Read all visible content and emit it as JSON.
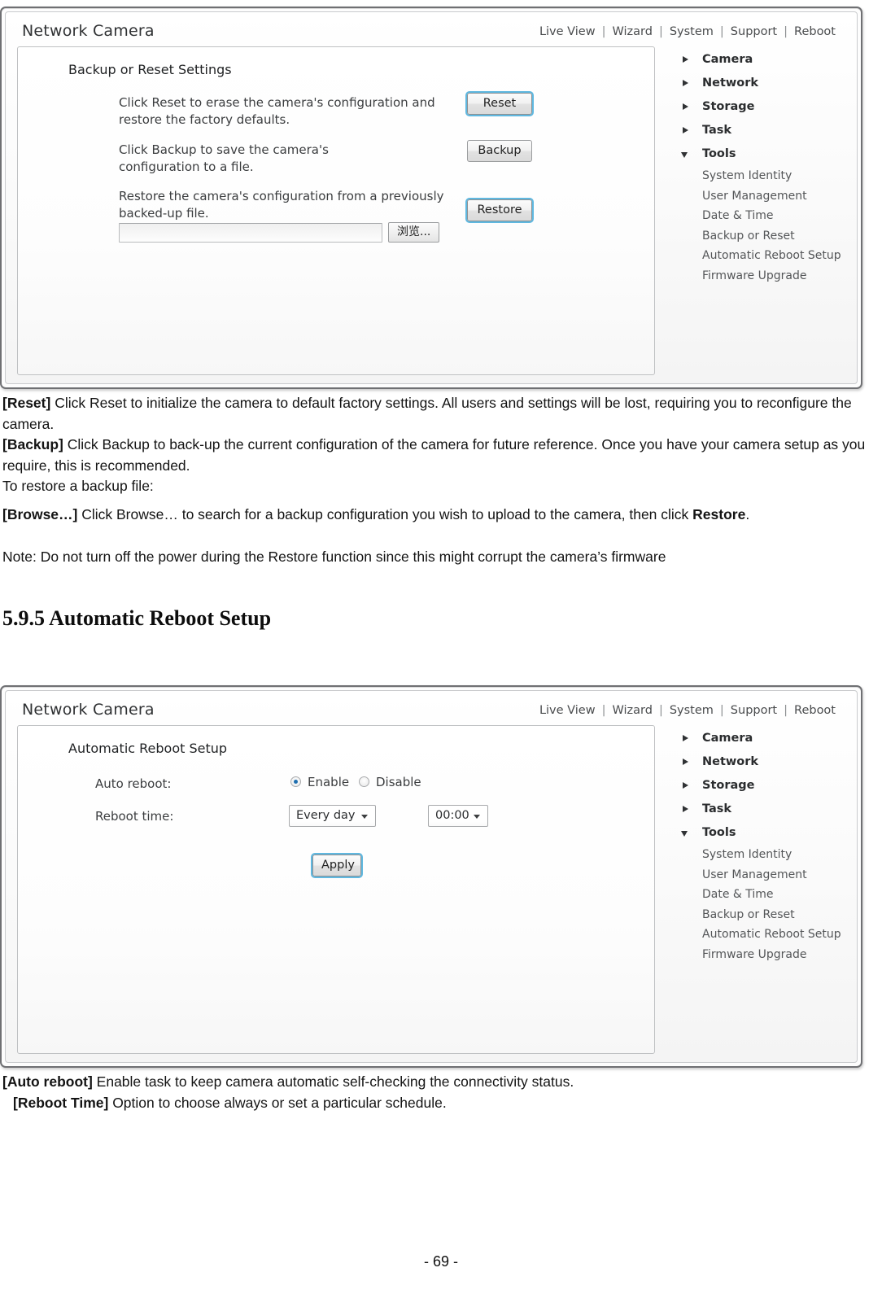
{
  "page": {
    "number_label": "- 69 -"
  },
  "screenshot1": {
    "brand": "Network Camera",
    "nav": [
      "Live View",
      "Wizard",
      "System",
      "Support",
      "Reboot"
    ],
    "nav_separator": "|",
    "section_title": "Backup or Reset Settings",
    "rows": [
      {
        "desc": "Click Reset to erase the camera's configuration and restore the factory defaults.",
        "button": "Reset"
      },
      {
        "desc": "Click Backup to save the camera's configuration to a file.",
        "button": "Backup"
      },
      {
        "desc": "Restore the camera's configuration from a previously backed-up file.",
        "button": "Restore"
      }
    ],
    "file_input_value": "",
    "browse_button": "浏览...",
    "sidebar": [
      {
        "label": "Camera",
        "type": "group",
        "expanded": false
      },
      {
        "label": "Network",
        "type": "group",
        "expanded": false
      },
      {
        "label": "Storage",
        "type": "group",
        "expanded": false
      },
      {
        "label": "Task",
        "type": "group",
        "expanded": false
      },
      {
        "label": "Tools",
        "type": "group",
        "expanded": true
      },
      {
        "label": "System Identity",
        "type": "leaf"
      },
      {
        "label": "User Management",
        "type": "leaf"
      },
      {
        "label": "Date & Time",
        "type": "leaf"
      },
      {
        "label": "Backup or Reset",
        "type": "leaf"
      },
      {
        "label": "Automatic Reboot Setup",
        "type": "leaf"
      },
      {
        "label": "Firmware Upgrade",
        "type": "leaf"
      }
    ]
  },
  "body_text_1": {
    "p1_bold": "[Reset]",
    "p1": " Click Reset to initialize the camera to default factory settings. All users and settings will be lost, requiring you to reconfigure the camera.",
    "p2_bold": "[Backup]",
    "p2": " Click Backup to back-up the current configuration of the camera for future reference. Once you have your camera setup as you require, this is recommended.",
    "p3": "To restore a backup file:",
    "p4_bold": "[Browse…]",
    "p4a": " Click Browse… to search for a backup configuration you wish to upload to the camera, then click ",
    "p4_bold2": "Restore",
    "p4b": ".",
    "p5": "Note: Do not turn off the power during the Restore function since this might corrupt the camera’s firmware"
  },
  "heading": {
    "text": "5.9.5 Automatic Reboot Setup"
  },
  "screenshot2": {
    "brand": "Network Camera",
    "nav": [
      "Live View",
      "Wizard",
      "System",
      "Support",
      "Reboot"
    ],
    "nav_separator": "|",
    "section_title": "Automatic Reboot Setup",
    "auto_reboot_label": "Auto reboot:",
    "enable_label": "Enable",
    "disable_label": "Disable",
    "auto_reboot_selected": "Enable",
    "reboot_time_label": "Reboot time:",
    "reboot_day_value": "Every day",
    "reboot_clock_value": "00:00",
    "apply_button": "Apply",
    "sidebar": [
      {
        "label": "Camera",
        "type": "group",
        "expanded": false
      },
      {
        "label": "Network",
        "type": "group",
        "expanded": false
      },
      {
        "label": "Storage",
        "type": "group",
        "expanded": false
      },
      {
        "label": "Task",
        "type": "group",
        "expanded": false
      },
      {
        "label": "Tools",
        "type": "group",
        "expanded": true
      },
      {
        "label": "System Identity",
        "type": "leaf"
      },
      {
        "label": "User Management",
        "type": "leaf"
      },
      {
        "label": "Date & Time",
        "type": "leaf"
      },
      {
        "label": "Backup or Reset",
        "type": "leaf"
      },
      {
        "label": "Automatic Reboot Setup",
        "type": "leaf"
      },
      {
        "label": "Firmware Upgrade",
        "type": "leaf"
      }
    ]
  },
  "body_text_2": {
    "p1_bold": "[Auto reboot]",
    "p1": " Enable task to keep camera automatic self-checking the connectivity status.",
    "p2_bold": "[Reboot Time]",
    "p2": " Option to choose always or set a particular schedule."
  },
  "colors": {
    "focus_outline": "#5fb8e0",
    "radio_dot": "#1f6fb0",
    "panel_border": "#6f7073",
    "text": "#141414"
  }
}
